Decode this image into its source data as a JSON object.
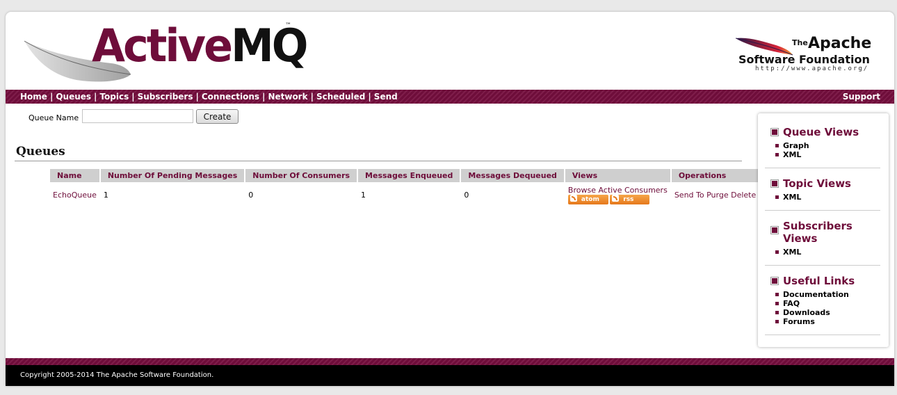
{
  "header": {
    "logo_text_a": "Active",
    "logo_text_b": "MQ",
    "logo_tm": "™",
    "apache_the": "The",
    "apache_name": "Apache",
    "apache_sf": "Software Foundation",
    "apache_url": "http://www.apache.org/"
  },
  "nav": {
    "items": [
      "Home",
      "Queues",
      "Topics",
      "Subscribers",
      "Connections",
      "Network",
      "Scheduled",
      "Send"
    ],
    "support": "Support"
  },
  "form": {
    "label": "Queue Name",
    "input_value": "",
    "button": "Create"
  },
  "page_title": "Queues",
  "table": {
    "headers": [
      "Name",
      "Number Of Pending Messages",
      "Number Of Consumers",
      "Messages Enqueued",
      "Messages Dequeued",
      "Views",
      "Operations"
    ],
    "rows": [
      {
        "name": "EchoQueue",
        "pending": "1",
        "consumers": "0",
        "enqueued": "1",
        "dequeued": "0",
        "browse": "Browse Active Consumers",
        "atom": "atom",
        "rss": "rss",
        "op_send": "Send To",
        "op_purge": "Purge",
        "op_delete": "Delete"
      }
    ]
  },
  "sidebar": {
    "queue_views": {
      "title": "Queue Views",
      "items": [
        "Graph",
        "XML"
      ]
    },
    "topic_views": {
      "title": "Topic Views",
      "items": [
        "XML"
      ]
    },
    "subscribers_views": {
      "title_line1": "Subscribers",
      "title_line2": "Views",
      "items": [
        "XML"
      ]
    },
    "useful_links": {
      "title": "Useful Links",
      "items": [
        "Documentation",
        "FAQ",
        "Downloads",
        "Forums"
      ]
    }
  },
  "footer": {
    "copyright": "Copyright 2005-2014 The Apache Software Foundation."
  },
  "colors": {
    "brand": "#6e0d3a",
    "feed": "#e5781b"
  }
}
